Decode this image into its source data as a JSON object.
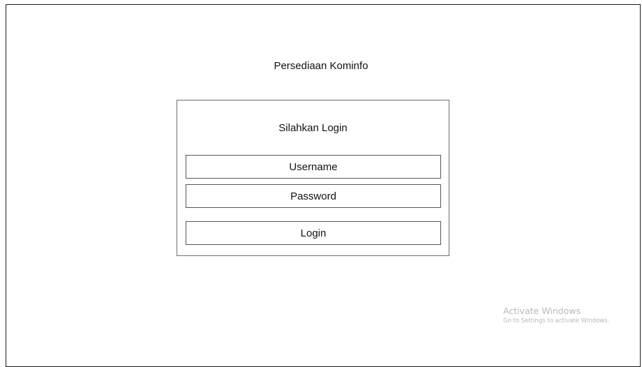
{
  "app": {
    "title": "Persediaan Kominfo"
  },
  "login": {
    "heading": "Silahkan Login",
    "username_label": "Username",
    "password_label": "Password",
    "submit_label": "Login"
  },
  "watermark": {
    "title": "Activate Windows",
    "subtitle": "Go to Settings to activate Windows."
  },
  "colors": {
    "background": "#ffffff",
    "border": "#555555",
    "watermark": "#b9b9b9"
  }
}
